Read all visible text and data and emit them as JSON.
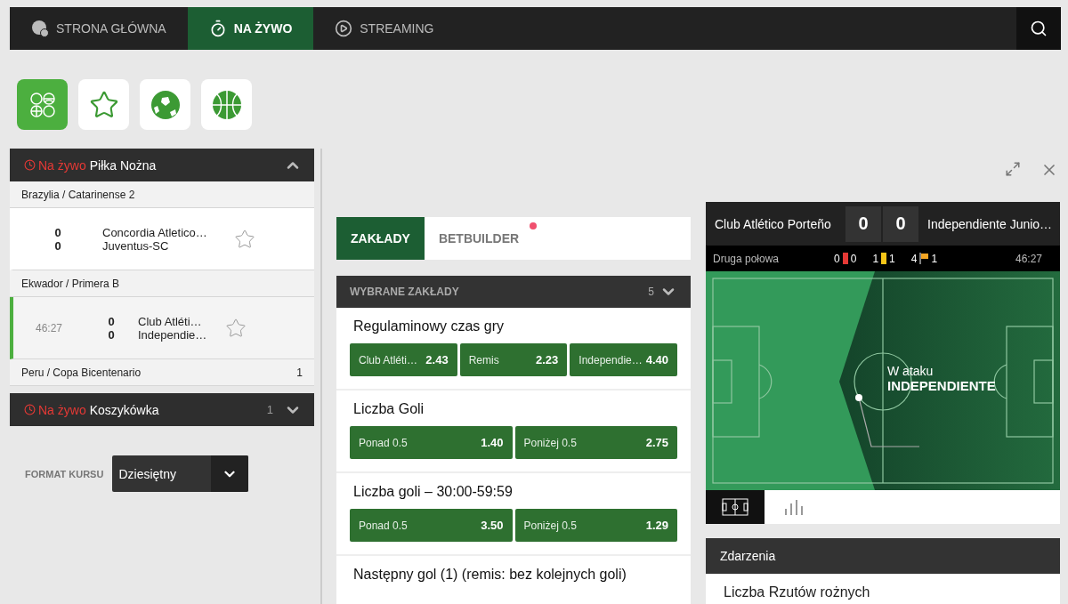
{
  "nav": {
    "items": [
      {
        "label": "STRONA GŁÓWNA",
        "selected": false
      },
      {
        "label": "NA ŻYWO",
        "selected": true
      },
      {
        "label": "STREAMING",
        "selected": false
      }
    ]
  },
  "sport_filters": [
    {
      "kind": "all",
      "selected": true
    },
    {
      "kind": "favorites",
      "selected": false
    },
    {
      "kind": "football",
      "selected": false
    },
    {
      "kind": "basketball",
      "selected": false
    }
  ],
  "sections": [
    {
      "live_label": "Na żywo",
      "title": "Piłka Nożna",
      "expanded": true,
      "groups": [
        {
          "league": "Brazylia / Catarinense 2",
          "matches": [
            {
              "home_score": "0",
              "away_score": "0",
              "home": "Concordia Atletico…",
              "away": "Juventus-SC",
              "selected": false
            }
          ]
        },
        {
          "league": "Ekwador / Primera B",
          "matches": [
            {
              "time": "46:27",
              "home_score": "0",
              "away_score": "0",
              "home": "Club Atléti…",
              "away": "Independie…",
              "selected": true
            }
          ]
        },
        {
          "league": "Peru / Copa Bicentenario",
          "count": "1"
        }
      ]
    },
    {
      "live_label": "Na żywo",
      "title": "Koszykówka",
      "count": "1",
      "expanded": false
    }
  ],
  "odds_format": {
    "label": "FORMAT KURSU",
    "value": "Dziesiętny"
  },
  "bet_tabs": [
    {
      "label": "ZAKŁADY",
      "selected": true,
      "notification": false
    },
    {
      "label": "BETBUILDER",
      "selected": false,
      "notification": true
    }
  ],
  "selected_bets": {
    "title": "WYBRANE ZAKŁADY",
    "count": "5",
    "markets": [
      {
        "title": "Regulaminowy czas gry",
        "outcomes": [
          {
            "label": "Club Atléti…",
            "odds": "2.43"
          },
          {
            "label": "Remis",
            "odds": "2.23"
          },
          {
            "label": "Independie…",
            "odds": "4.40"
          }
        ]
      },
      {
        "title": "Liczba Goli",
        "outcomes": [
          {
            "label": "Ponad 0.5",
            "odds": "1.40"
          },
          {
            "label": "Poniżej 0.5",
            "odds": "2.75"
          }
        ]
      },
      {
        "title": "Liczba goli – 30:00-59:59",
        "outcomes": [
          {
            "label": "Ponad 0.5",
            "odds": "3.50"
          },
          {
            "label": "Poniżej 0.5",
            "odds": "1.29"
          }
        ]
      },
      {
        "title": "Następny gol (1) (remis: bez kolejnych goli)"
      }
    ]
  },
  "scoreboard": {
    "home": "Club Atlético Porteño",
    "home_score": "0",
    "away_score": "0",
    "away": "Independiente Junio…"
  },
  "match_status": {
    "period": "Druga połowa",
    "stats": [
      {
        "kind": "red_card",
        "home": "0",
        "away": "0"
      },
      {
        "kind": "yellow_card",
        "home": "1",
        "away": "1"
      },
      {
        "kind": "corner",
        "home": "4",
        "away": "1"
      }
    ],
    "time": "46:27"
  },
  "pitch": {
    "attack_label": "W ataku",
    "team": "INDEPENDIENTE"
  },
  "view_tabs": [
    {
      "kind": "pitch",
      "selected": true
    },
    {
      "kind": "stats",
      "selected": false
    }
  ],
  "events": {
    "title": "Zdarzenia",
    "items": [
      "Liczba Rzutów rożnych"
    ]
  }
}
